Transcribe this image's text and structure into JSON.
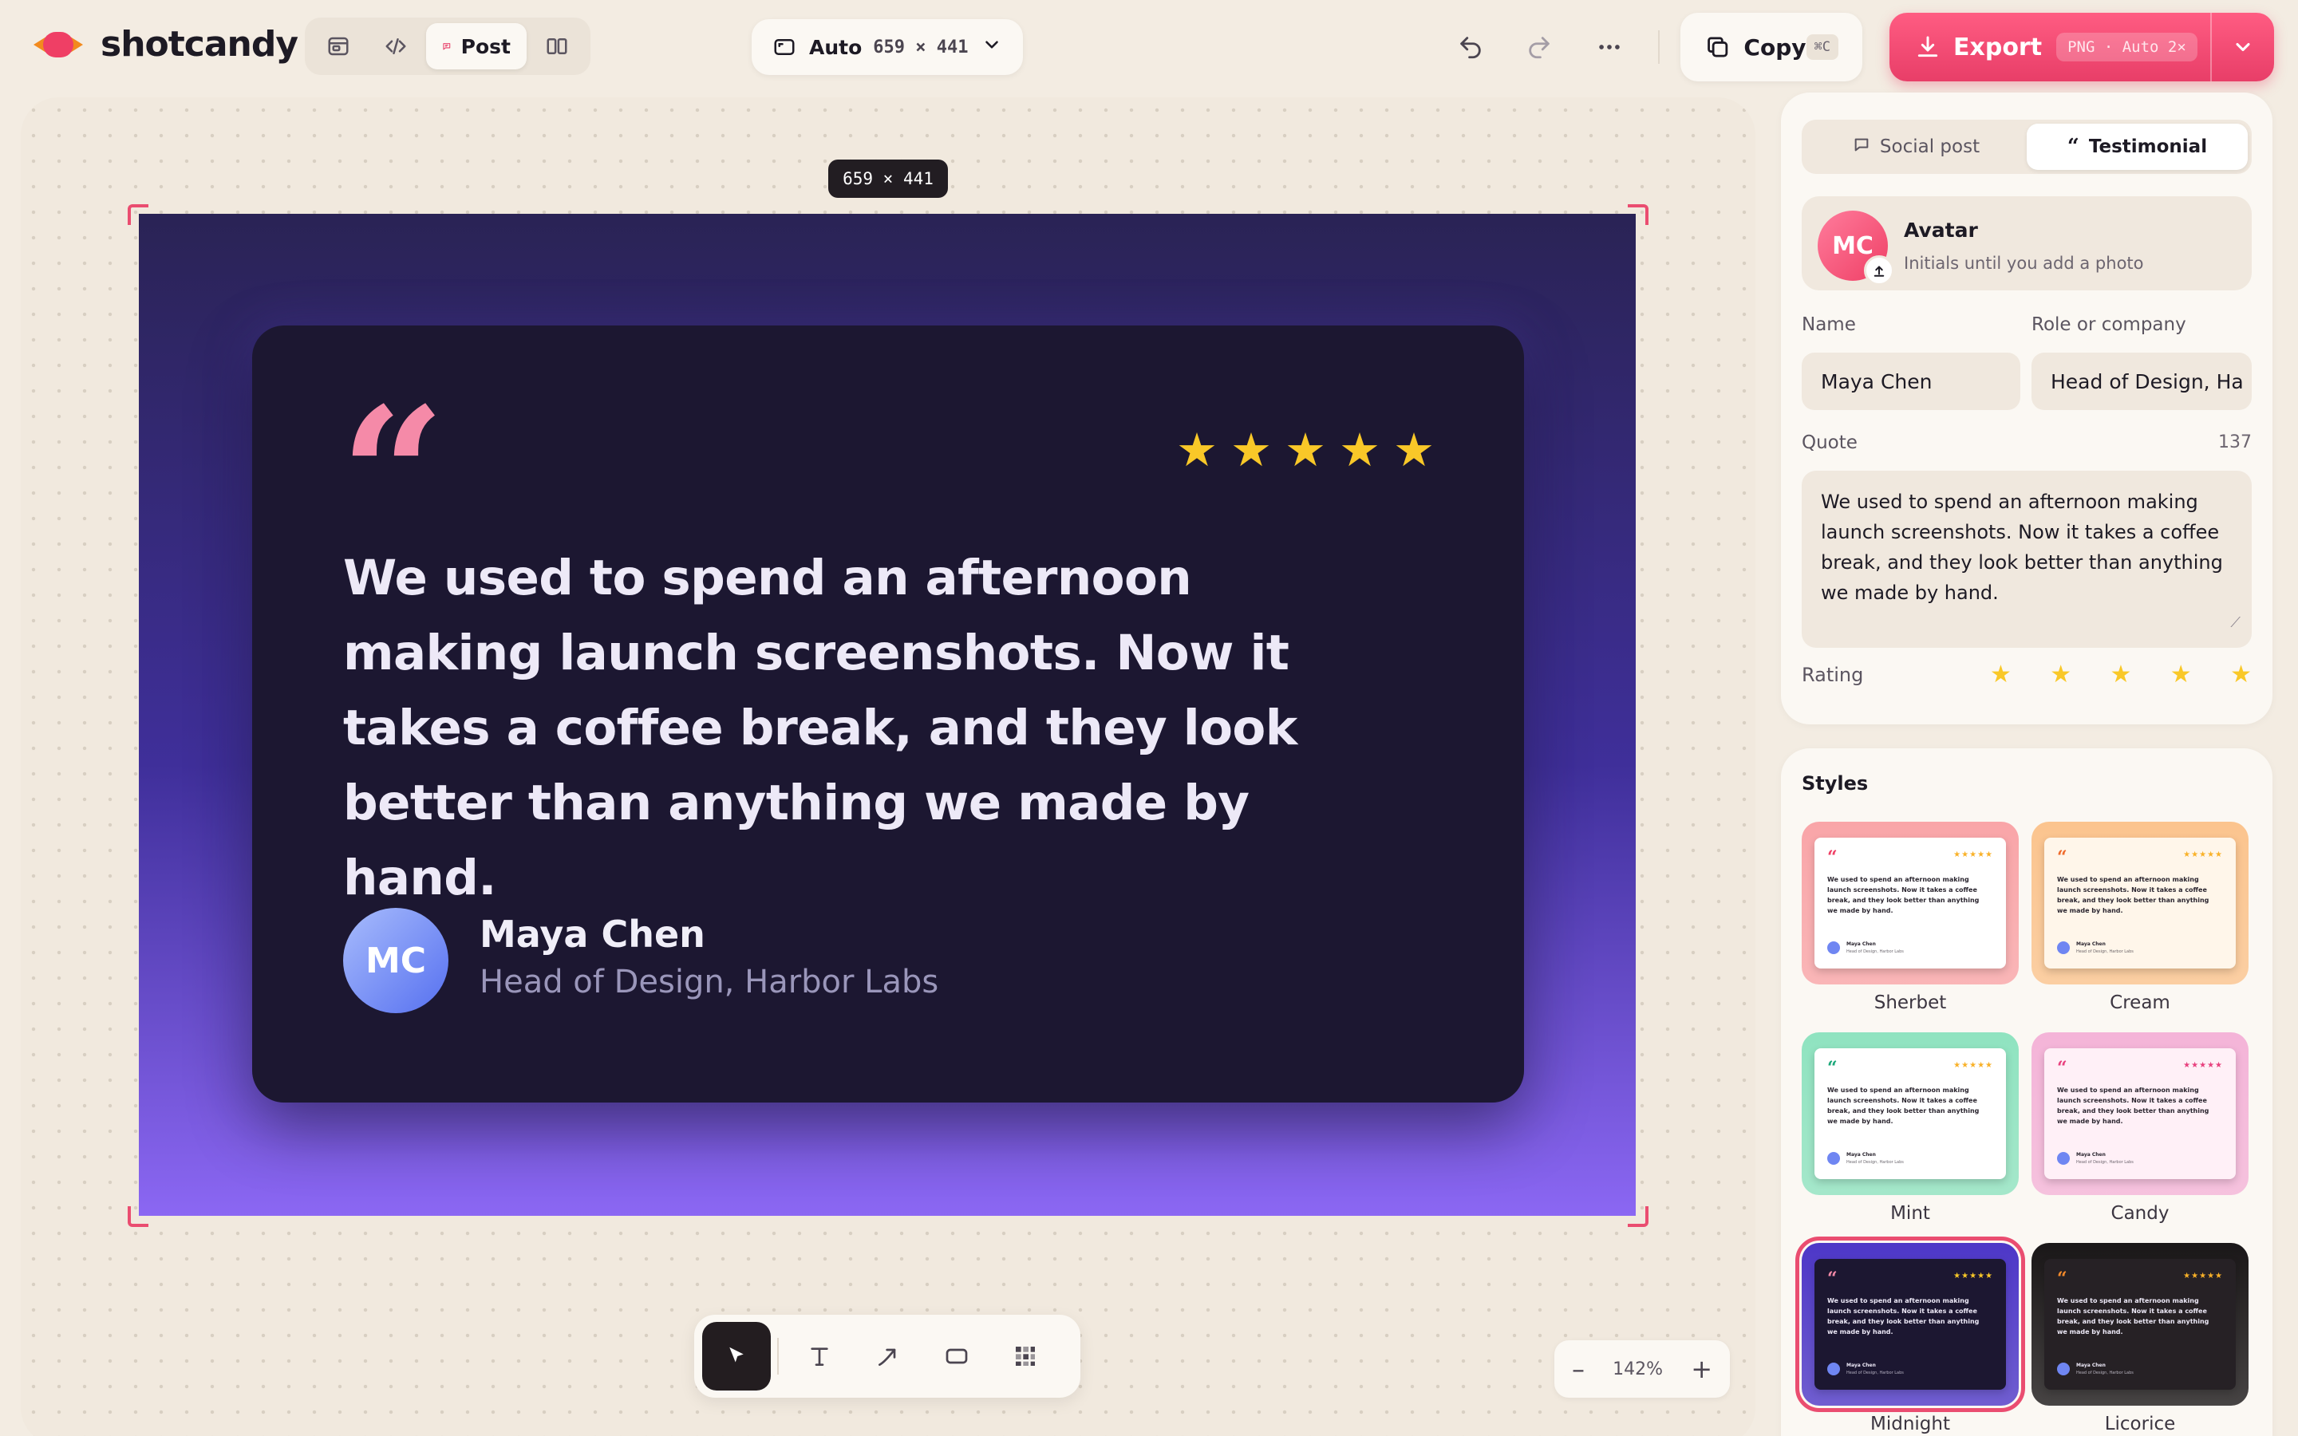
{
  "app": {
    "name": "shotcandy"
  },
  "toolbar": {
    "mode_active_label": "Post",
    "size_mode": "Auto",
    "size_dims": "659 × 441",
    "copy_label": "Copy",
    "copy_shortcut": "⌘C",
    "export_label": "Export",
    "export_badge": "PNG · Auto 2×",
    "accent_color": "#e83e68"
  },
  "canvas": {
    "size_tag": "659 × 441",
    "zoom": "142%",
    "tools": [
      "select-icon",
      "text-icon",
      "arrow-icon",
      "rectangle-icon",
      "grid-icon"
    ],
    "active_tool": "select"
  },
  "testimonial": {
    "quote_mark": "“",
    "stars": 5,
    "text": "We used to spend an afternoon making launch screenshots. Now it takes a coffee break, and they look better than anything we made by hand.",
    "initials": "MC",
    "name": "Maya Chen",
    "role": "Head of Design, Harbor Labs"
  },
  "panel": {
    "tabs": [
      {
        "label": "Social post",
        "icon": "chat-icon",
        "active": false
      },
      {
        "label": "Testimonial",
        "icon": "quote-icon",
        "active": true
      }
    ],
    "avatar": {
      "initials": "MC",
      "title": "Avatar",
      "subtitle": "Initials until you add a photo"
    },
    "name_label": "Name",
    "name_value": "Maya Chen",
    "role_label": "Role or company",
    "role_value": "Head of Design, Ha",
    "quote_label": "Quote",
    "quote_count": "137",
    "quote_value": "We used to spend an afternoon making launch screenshots. Now it takes a coffee break, and they look better than anything we made by hand.",
    "rating_label": "Rating",
    "rating_value": 5
  },
  "styles": {
    "title": "Styles",
    "selected": "Midnight",
    "items": [
      {
        "name": "Sherbet",
        "bg": "#f9a5a8",
        "card": "#ffffff",
        "text": "#2b2630",
        "quote": "#ef3f65",
        "star": "#f9b128"
      },
      {
        "name": "Cream",
        "bg": "#fbc48e",
        "card": "#fff6ea",
        "text": "#2b2630",
        "quote": "#ef6a2b",
        "star": "#f9b128"
      },
      {
        "name": "Mint",
        "bg": "#8fe3c0",
        "card": "#ffffff",
        "text": "#2b2630",
        "quote": "#1aa779",
        "star": "#f9b128"
      },
      {
        "name": "Candy",
        "bg": "#f4b4d8",
        "card": "#fff0f7",
        "text": "#2b2630",
        "quote": "#e8407e",
        "star": "#e8407e"
      },
      {
        "name": "Midnight",
        "bg": "#4d37c7",
        "card": "#1c1731",
        "text": "#ede9f7",
        "quote": "#f58aa8",
        "star": "#f9c828"
      },
      {
        "name": "Licorice",
        "bg": "#1a1718",
        "card": "#262125",
        "text": "#ede9f7",
        "quote": "#f58a2b",
        "star": "#f9b128"
      }
    ],
    "mini_text": "We used to spend an afternoon making launch screenshots. Now it takes a coffee break, and they look better than anything we made by hand.",
    "mini_name": "Maya Chen",
    "mini_role": "Head of Design, Harbor Labs"
  }
}
